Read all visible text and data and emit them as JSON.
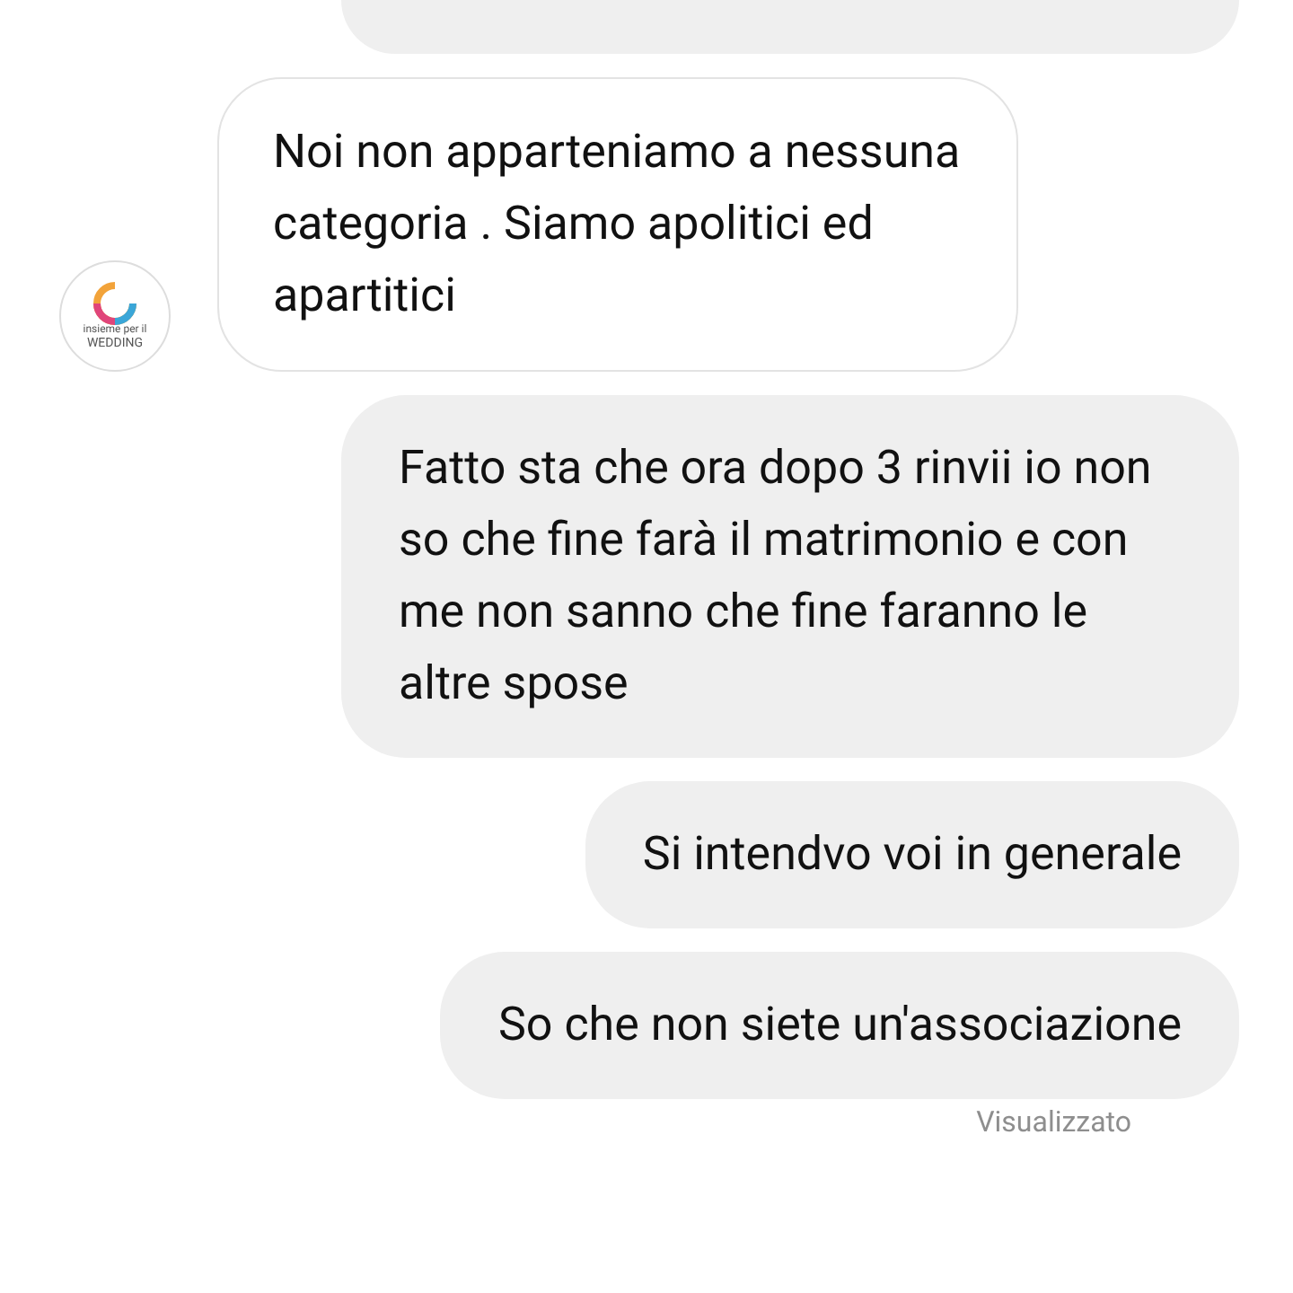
{
  "contact": {
    "logo_line_1": "insieme per il",
    "logo_line_2": "WEDDING"
  },
  "messages": [
    {
      "kind": "incoming",
      "text": "Noi non apparteniamo a nessuna categoria . Siamo apolitici ed apartitici"
    },
    {
      "kind": "outgoing",
      "text": "Fatto sta che ora dopo 3 rinvii io non so che fine farà il matrimonio e con me non sanno che fine faranno le altre spose"
    },
    {
      "kind": "outgoing",
      "text": "Si intendvo voi in generale"
    },
    {
      "kind": "outgoing",
      "text": "So che non siete un'associazione"
    }
  ],
  "status": "Visualizzato"
}
